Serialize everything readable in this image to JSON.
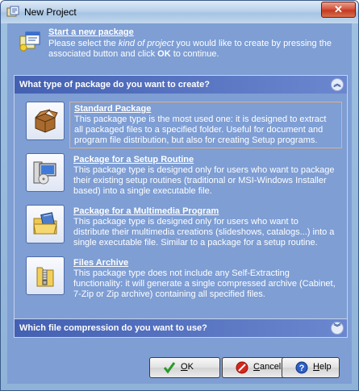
{
  "window": {
    "title": "New Project",
    "close_label": "✕"
  },
  "header": {
    "title": "Start a new package",
    "desc_part1": "Please select the ",
    "desc_em": "kind of project",
    "desc_part2": " you would like to create by pressing the associated button and click ",
    "desc_ok": "OK",
    "desc_part3": " to continue."
  },
  "panel_type": {
    "title": "What type of package do you want to create?",
    "expanded": true
  },
  "options": [
    {
      "title": "Standard Package",
      "desc": "This package type is the most used one: it is designed to extract all packaged files to a specified folder. Useful for document and program file distribution, but also for creating Setup programs.",
      "selected": true,
      "icon": "package-box-icon"
    },
    {
      "title": "Package for a Setup Routine",
      "desc": "This package type is designed only for users who want to package their existing setup routines (traditional or MSI-Windows Installer based) into a single executable file.",
      "selected": false,
      "icon": "setup-computer-icon"
    },
    {
      "title": "Package for a Multimedia Program",
      "desc": "This package type is designed only for users who want to distribute their multimedia creations (slideshows, catalogs...) into a single executable file. Similar to a package for a setup routine.",
      "selected": false,
      "icon": "multimedia-folder-icon"
    },
    {
      "title": "Files Archive",
      "desc": "This package type does not include any Self-Extracting functionality: it will generate a single compressed archive (Cabinet, 7-Zip or Zip archive) containing all specified files.",
      "selected": false,
      "icon": "zip-archive-icon"
    }
  ],
  "panel_compression": {
    "title": "Which file compression do you want to use?",
    "expanded": false
  },
  "buttons": {
    "ok": "OK",
    "cancel": "Cancel",
    "help": "Help"
  },
  "colors": {
    "panel_head": "#4360b2",
    "client_bg": "#7e9ed4",
    "selected_border": "#e6b07a"
  }
}
